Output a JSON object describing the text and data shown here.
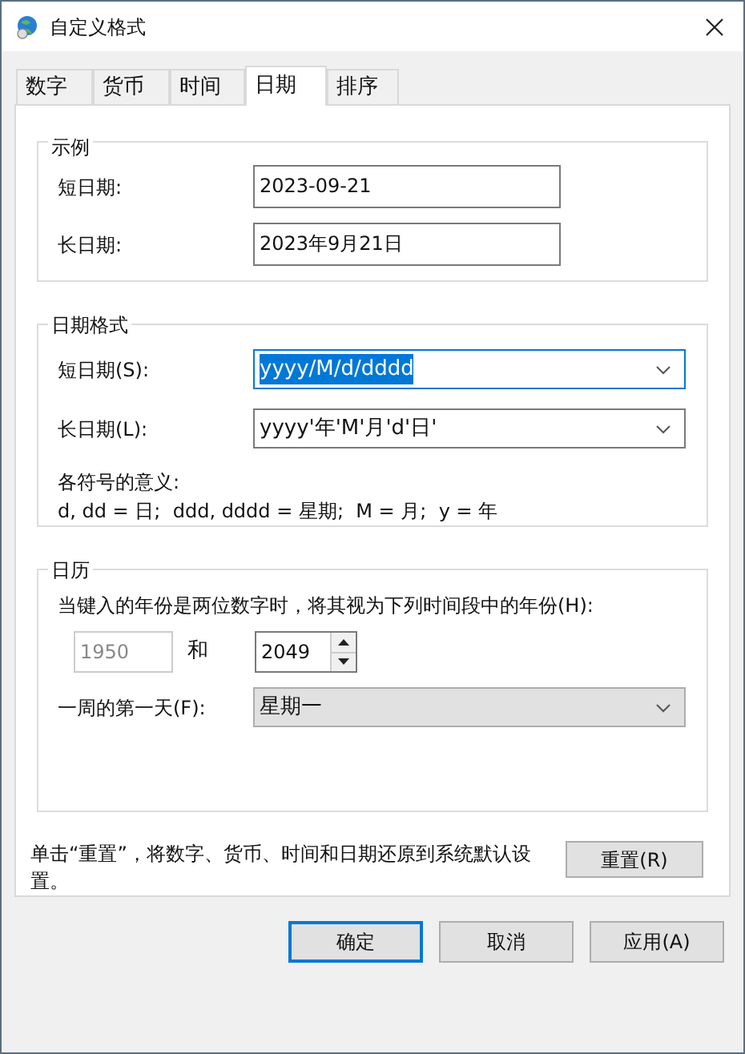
{
  "window": {
    "title": "自定义格式"
  },
  "tabs": [
    {
      "label": "数字",
      "selected": false
    },
    {
      "label": "货币",
      "selected": false
    },
    {
      "label": "时间",
      "selected": false
    },
    {
      "label": "日期",
      "selected": true
    },
    {
      "label": "排序",
      "selected": false
    }
  ],
  "example": {
    "title": "示例",
    "rows": [
      {
        "label": "短日期:",
        "value": "2023-09-21"
      },
      {
        "label": "长日期:",
        "value": "2023年9月21日"
      }
    ]
  },
  "date_formats": {
    "title": "日期格式",
    "rows": [
      {
        "label": "短日期(S):",
        "value": "yyyy/M/d/dddd",
        "selected": true
      },
      {
        "label": "长日期(L):",
        "value": "yyyy'年'M'月'd'日'",
        "selected": false
      }
    ],
    "legend_title": "各符号的意义:",
    "legend": "d, dd = 日;  ddd, dddd = 星期;  M = 月;  y = 年"
  },
  "calendar": {
    "title": "日历",
    "two_digit_label": "当键入的年份是两位数字时，将其视为下列时间段中的年份(H):",
    "start_year": {
      "value": "1950",
      "disabled": true
    },
    "and_label": "和",
    "end_year": {
      "value": "2049",
      "disabled": false
    },
    "first_day_label": "一周的第一天(F):",
    "first_day_value": "星期一"
  },
  "reset_note": "单击“重置”，将数字、货币、时间和日期还原到系统默认设置。",
  "reset_button": "重置(R)",
  "buttons": [
    {
      "label": "确定",
      "default": true
    },
    {
      "label": "取消",
      "default": false
    },
    {
      "label": "应用(A)",
      "default": false
    }
  ]
}
